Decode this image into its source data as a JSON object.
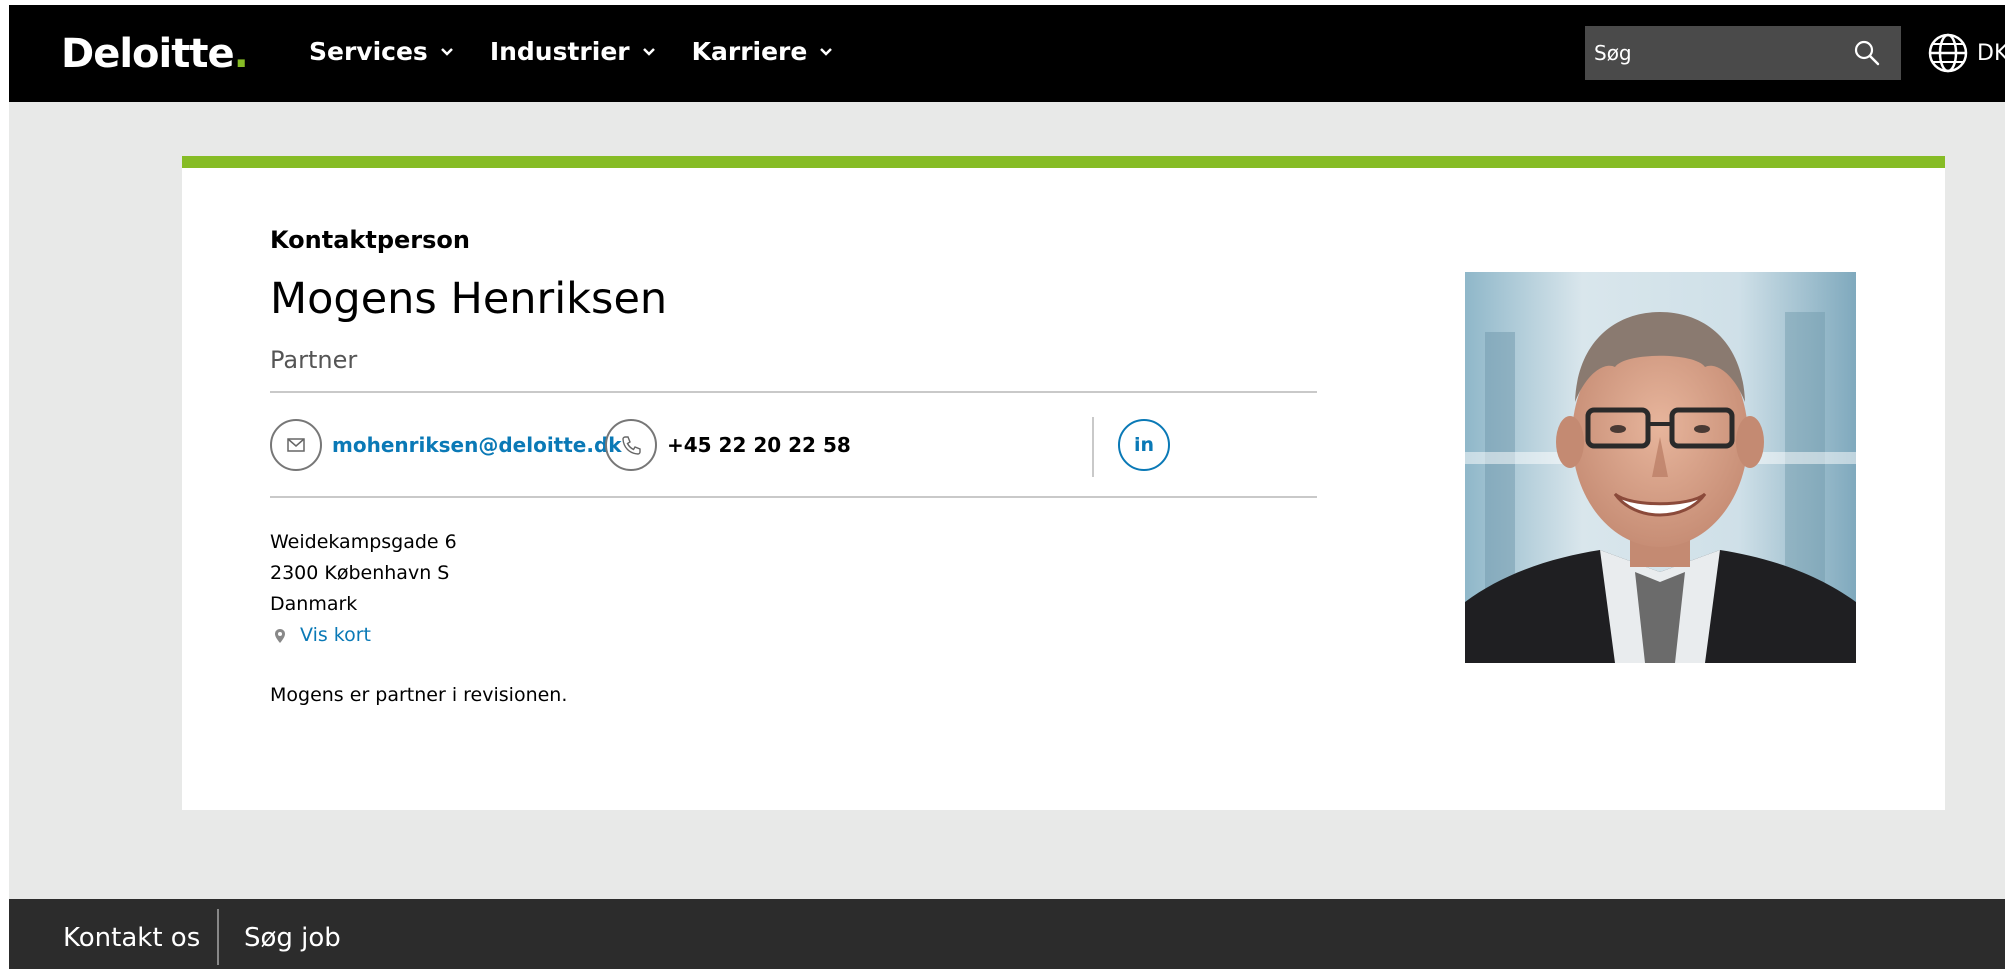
{
  "header": {
    "logo_text": "Deloitte",
    "logo_dot": ".",
    "nav": [
      {
        "label": "Services"
      },
      {
        "label": "Industrier"
      },
      {
        "label": "Karriere"
      }
    ],
    "search": {
      "placeholder": "Søg",
      "value": "",
      "icon": "search-icon"
    },
    "language": {
      "icon": "globe-icon",
      "label": "DK"
    }
  },
  "card": {
    "section_label": "Kontaktperson",
    "name": "Mogens Henriksen",
    "role": "Partner",
    "email": "mohenriksen@deloitte.dk",
    "phone": "+45 22 20 22 58",
    "linkedin_label": "in",
    "address": {
      "line1": "Weidekampsgade 6",
      "line2": "2300 København S",
      "line3": "Danmark",
      "map_link": "Vis kort"
    },
    "bio": "Mogens er partner i revisionen."
  },
  "footer": {
    "links": [
      {
        "label": "Kontakt os"
      },
      {
        "label": "Søg job"
      }
    ]
  },
  "colors": {
    "accent_green": "#86bc25",
    "link_blue": "#0a79b6",
    "header_bg": "#000000",
    "footer_bg": "#2c2c2c",
    "page_bg": "#e8e9e8"
  }
}
